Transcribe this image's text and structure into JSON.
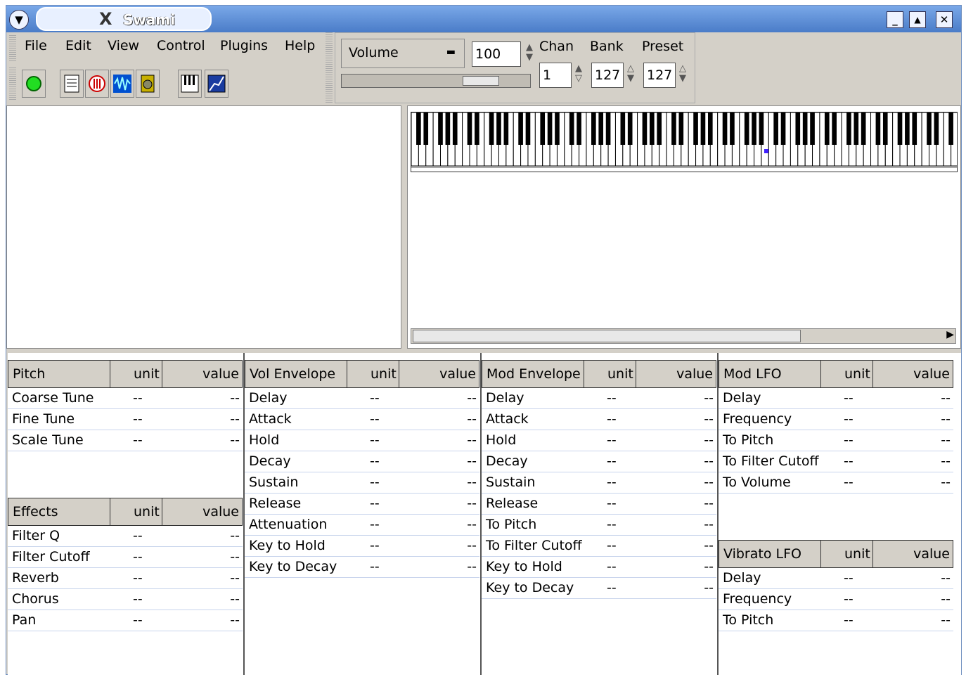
{
  "window": {
    "title": "Swami",
    "menu_icon": "chevron-down-icon",
    "app_icon": "x-icon"
  },
  "window_controls": {
    "minimize": "_",
    "maximize": "▲",
    "close": "✕"
  },
  "menu": [
    "File",
    "Edit",
    "View",
    "Control",
    "Plugins",
    "Help"
  ],
  "toolbar": {
    "buttons": [
      "power-led-icon",
      "list-icon",
      "mixer-icon",
      "wave-icon",
      "speaker-icon",
      "piano-icon",
      "graph-icon"
    ]
  },
  "controls": {
    "volume_label": "Volume",
    "volume_value": "100",
    "chan_label": "Chan",
    "chan_value": "1",
    "bank_label": "Bank",
    "bank_value": "127",
    "preset_label": "Preset",
    "preset_value": "127"
  },
  "tables": {
    "pitch": {
      "title": "Pitch",
      "unit": "unit",
      "value": "value",
      "rows": [
        [
          "Coarse Tune",
          "--",
          "--"
        ],
        [
          "Fine Tune",
          "--",
          "--"
        ],
        [
          "Scale Tune",
          "--",
          "--"
        ]
      ]
    },
    "effects": {
      "title": "Effects",
      "unit": "unit",
      "value": "value",
      "rows": [
        [
          "Filter Q",
          "--",
          "--"
        ],
        [
          "Filter Cutoff",
          "--",
          "--"
        ],
        [
          "Reverb",
          "--",
          "--"
        ],
        [
          "Chorus",
          "--",
          "--"
        ],
        [
          "Pan",
          "--",
          "--"
        ]
      ]
    },
    "vol_env": {
      "title": "Vol Envelope",
      "unit": "unit",
      "value": "value",
      "rows": [
        [
          "Delay",
          "--",
          "--"
        ],
        [
          "Attack",
          "--",
          "--"
        ],
        [
          "Hold",
          "--",
          "--"
        ],
        [
          "Decay",
          "--",
          "--"
        ],
        [
          "Sustain",
          "--",
          "--"
        ],
        [
          "Release",
          "--",
          "--"
        ],
        [
          "Attenuation",
          "--",
          "--"
        ],
        [
          "Key to Hold",
          "--",
          "--"
        ],
        [
          "Key to Decay",
          "--",
          "--"
        ]
      ]
    },
    "mod_env": {
      "title": "Mod Envelope",
      "unit": "unit",
      "value": "value",
      "rows": [
        [
          "Delay",
          "--",
          "--"
        ],
        [
          "Attack",
          "--",
          "--"
        ],
        [
          "Hold",
          "--",
          "--"
        ],
        [
          "Decay",
          "--",
          "--"
        ],
        [
          "Sustain",
          "--",
          "--"
        ],
        [
          "Release",
          "--",
          "--"
        ],
        [
          "To Pitch",
          "--",
          "--"
        ],
        [
          "To Filter Cutoff",
          "--",
          "--"
        ],
        [
          "Key to Hold",
          "--",
          "--"
        ],
        [
          "Key to Decay",
          "--",
          "--"
        ]
      ]
    },
    "mod_lfo": {
      "title": "Mod LFO",
      "unit": "unit",
      "value": "value",
      "rows": [
        [
          "Delay",
          "--",
          "--"
        ],
        [
          "Frequency",
          "--",
          "--"
        ],
        [
          "To Pitch",
          "--",
          "--"
        ],
        [
          "To Filter Cutoff",
          "--",
          "--"
        ],
        [
          "To Volume",
          "--",
          "--"
        ]
      ]
    },
    "vib_lfo": {
      "title": "Vibrato LFO",
      "unit": "unit",
      "value": "value",
      "rows": [
        [
          "Delay",
          "--",
          "--"
        ],
        [
          "Frequency",
          "--",
          "--"
        ],
        [
          "To Pitch",
          "--",
          "--"
        ]
      ]
    }
  }
}
